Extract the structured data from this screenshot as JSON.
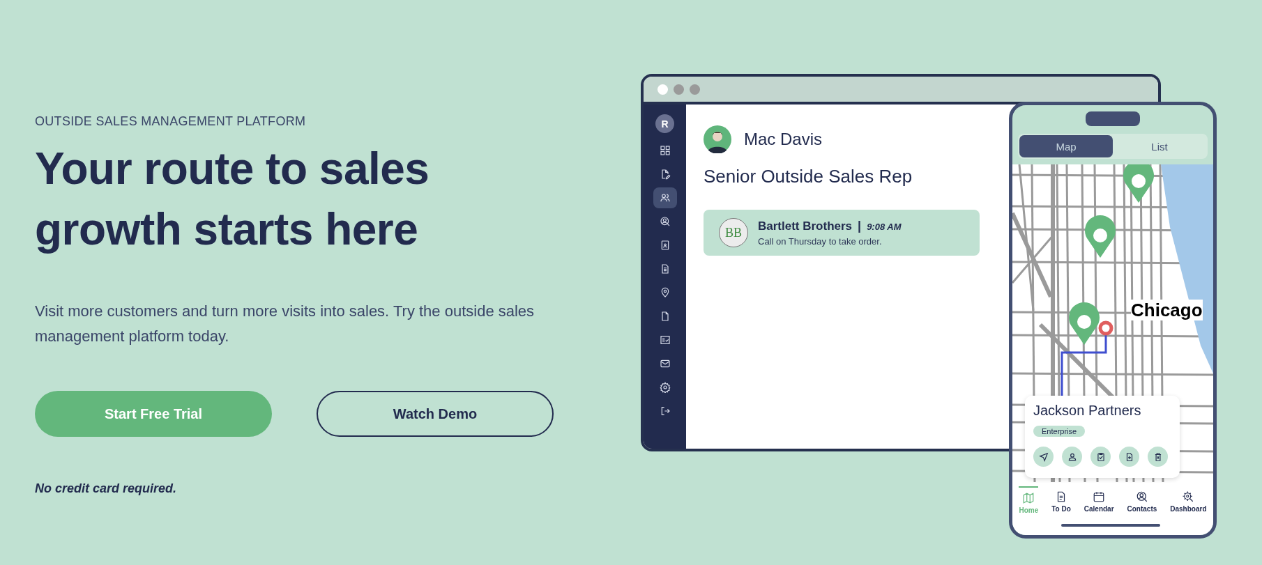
{
  "hero": {
    "eyebrow": "OUTSIDE SALES MANAGEMENT PLATFORM",
    "title": "Your route to sales growth starts here",
    "description": "Visit more customers and turn more visits into sales. Try the outside sales management platform today.",
    "buttons": [
      {
        "label": "Start Free Trial",
        "kind": "primary"
      },
      {
        "label": "Watch Demo",
        "kind": "outline"
      }
    ],
    "note": "No credit card required."
  },
  "desktop_app": {
    "logo": "R",
    "sidebar": {
      "items": [
        {
          "selected": false
        },
        {
          "selected": false
        },
        {
          "selected": true
        },
        {
          "selected": false
        },
        {
          "selected": false
        },
        {
          "selected": false
        },
        {
          "selected": false
        },
        {
          "selected": false
        },
        {
          "selected": false
        },
        {
          "selected": false
        },
        {
          "selected": false
        },
        {
          "selected": false
        }
      ]
    },
    "profile": {
      "name": "Mac Davis",
      "role": "Senior Outside Sales Rep"
    },
    "activity": {
      "logo": "BB",
      "company": "Bartlett Brothers",
      "separator": "|",
      "time": "9:08 AM",
      "note": "Call on Thursday to take order."
    }
  },
  "mobile_app": {
    "tabs": [
      {
        "label": "Map",
        "selected": true
      },
      {
        "label": "List",
        "selected": false
      }
    ],
    "map": {
      "city_label": "Chicago"
    },
    "place_card": {
      "name": "Jackson Partners",
      "tag": "Enterprise"
    },
    "nav": [
      {
        "label": "Home",
        "selected": true
      },
      {
        "label": "To Do",
        "selected": false
      },
      {
        "label": "Calendar",
        "selected": false
      },
      {
        "label": "Contacts",
        "selected": false
      },
      {
        "label": "Dashboard",
        "selected": false
      }
    ]
  }
}
